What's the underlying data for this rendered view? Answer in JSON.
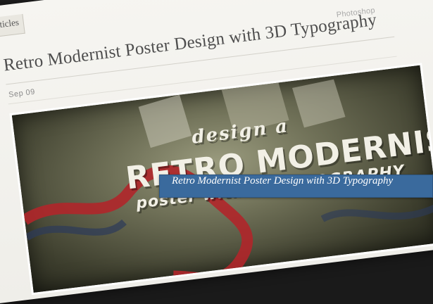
{
  "nav": {
    "tab_fragment": "ticles"
  },
  "post": {
    "category": "Photoshop",
    "title": "Retro Modernist Poster Design with 3D Typography",
    "date": "Sep 09"
  },
  "image_text": {
    "line1": "design a",
    "line2": "RETRO MODERNIST",
    "line3": "poster with 3D TYPOGRAPHY"
  },
  "caption": {
    "text": "Retro Modernist Poster Design with 3D Typography"
  },
  "colors": {
    "caption_bg": "#3a6a9d",
    "title_text": "#4e4e4e",
    "card_bg": "#f6f5f1"
  }
}
